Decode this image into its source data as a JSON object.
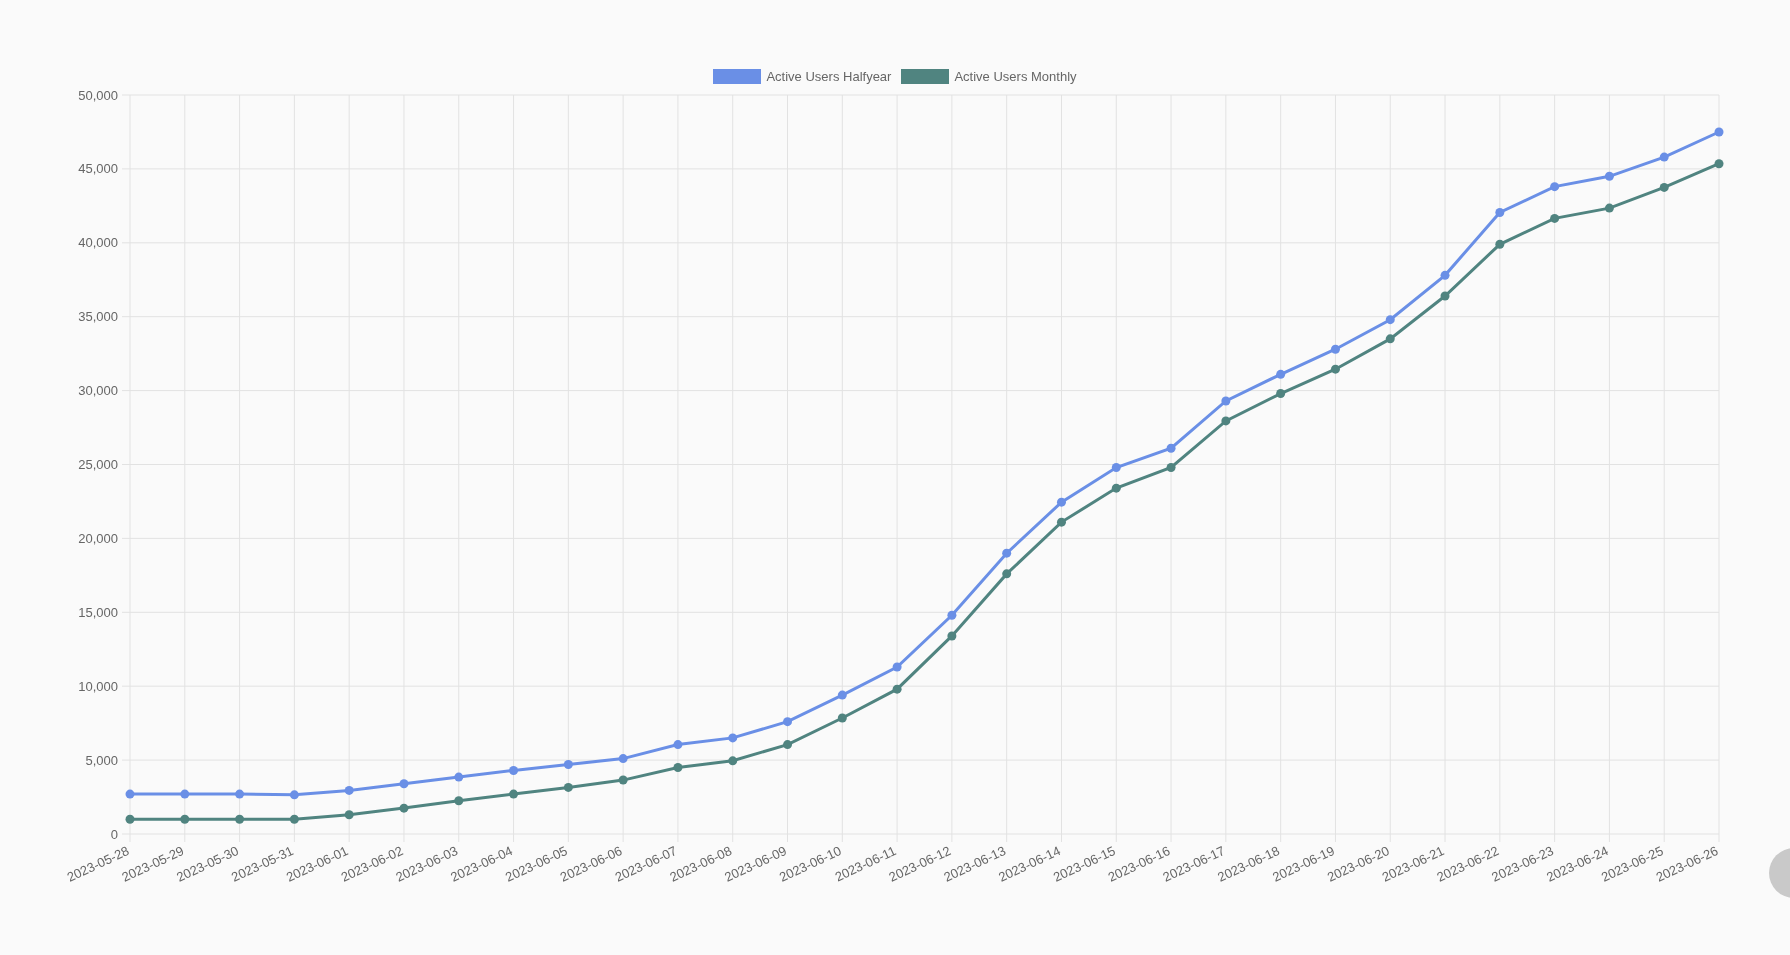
{
  "chart": {
    "chart_data": {
      "type": "line",
      "grid": true,
      "legend": true,
      "categories": [
        "2023-05-28",
        "2023-05-29",
        "2023-05-30",
        "2023-05-31",
        "2023-06-01",
        "2023-06-02",
        "2023-06-03",
        "2023-06-04",
        "2023-06-05",
        "2023-06-06",
        "2023-06-07",
        "2023-06-08",
        "2023-06-09",
        "2023-06-10",
        "2023-06-11",
        "2023-06-12",
        "2023-06-13",
        "2023-06-14",
        "2023-06-15",
        "2023-06-16",
        "2023-06-17",
        "2023-06-18",
        "2023-06-19",
        "2023-06-20",
        "2023-06-21",
        "2023-06-22",
        "2023-06-23",
        "2023-06-24",
        "2023-06-25",
        "2023-06-26"
      ],
      "series": [
        {
          "name": "Active Users Halfyear",
          "color": "#6a8fe6",
          "marker": "circle",
          "values": [
            2700,
            2700,
            2700,
            2650,
            2950,
            3400,
            3850,
            4300,
            4700,
            5100,
            6050,
            6500,
            7600,
            9400,
            11300,
            14800,
            19000,
            22450,
            24800,
            26100,
            29300,
            31100,
            32800,
            34800,
            37800,
            42050,
            43800,
            44500,
            45800,
            47500
          ]
        },
        {
          "name": "Active Users Monthly",
          "color": "#508480",
          "marker": "circle",
          "values": [
            1000,
            1000,
            1000,
            1000,
            1300,
            1750,
            2250,
            2700,
            3150,
            3650,
            4500,
            4950,
            6050,
            7850,
            9800,
            13400,
            17600,
            21100,
            23400,
            24800,
            27950,
            29800,
            31450,
            33500,
            36400,
            39900,
            41650,
            42350,
            43750,
            45350
          ]
        }
      ],
      "ylim": [
        0,
        50000
      ],
      "yticks": [
        {
          "value": 0,
          "label": "0"
        },
        {
          "value": 5000,
          "label": "5,000"
        },
        {
          "value": 10000,
          "label": "10,000"
        },
        {
          "value": 15000,
          "label": "15,000"
        },
        {
          "value": 20000,
          "label": "20,000"
        },
        {
          "value": 25000,
          "label": "25,000"
        },
        {
          "value": 30000,
          "label": "30,000"
        },
        {
          "value": 35000,
          "label": "35,000"
        },
        {
          "value": 40000,
          "label": "40,000"
        },
        {
          "value": 45000,
          "label": "45,000"
        },
        {
          "value": 50000,
          "label": "50,000"
        }
      ]
    }
  }
}
